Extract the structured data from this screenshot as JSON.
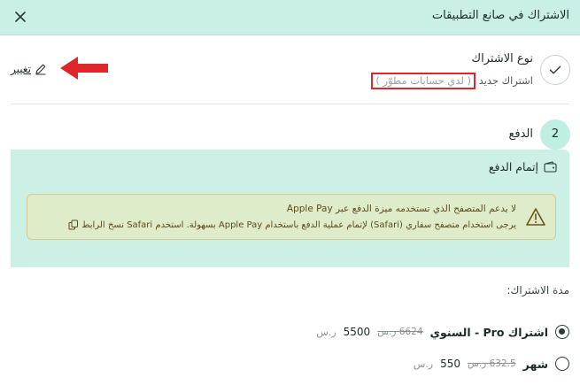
{
  "header": {
    "title": "الاشتراك في صانع التطبيقات"
  },
  "step1": {
    "title": "نوع الاشتراك",
    "subscription": "اشتراك جديد",
    "subscription_note": "( لدي حسابات مطوّر )",
    "change_label": "تغيير"
  },
  "step2": {
    "number": "2",
    "title": "الدفع",
    "payment_title": "إتمام الدفع",
    "warning_line1": "لا يدعم المتصفح الذي تستخدمه ميزة الدفع عبر Apple Pay",
    "warning_line2": "يرجى استخدام متصفح سفاري (Safari) لإتمام عملية الدفع باستخدام Apple Pay بسهولة. استخدم Safari نسخ الرابط"
  },
  "duration_label": "مدة الاشتراك:",
  "plans": [
    {
      "name": "اشتراك Pro - السنوي",
      "old_price": "6624 ر.س",
      "new_price": "5500",
      "currency": "ر.س",
      "selected": true
    },
    {
      "name": "شهر",
      "old_price": "632.5 ر.س",
      "new_price": "550",
      "currency": "ر.س",
      "selected": false
    }
  ],
  "colors": {
    "header_bg": "#c9efe6",
    "panel_bg": "#cdf0e6",
    "warning_bg": "#dfecc9",
    "highlight_red": "#e1252b"
  }
}
